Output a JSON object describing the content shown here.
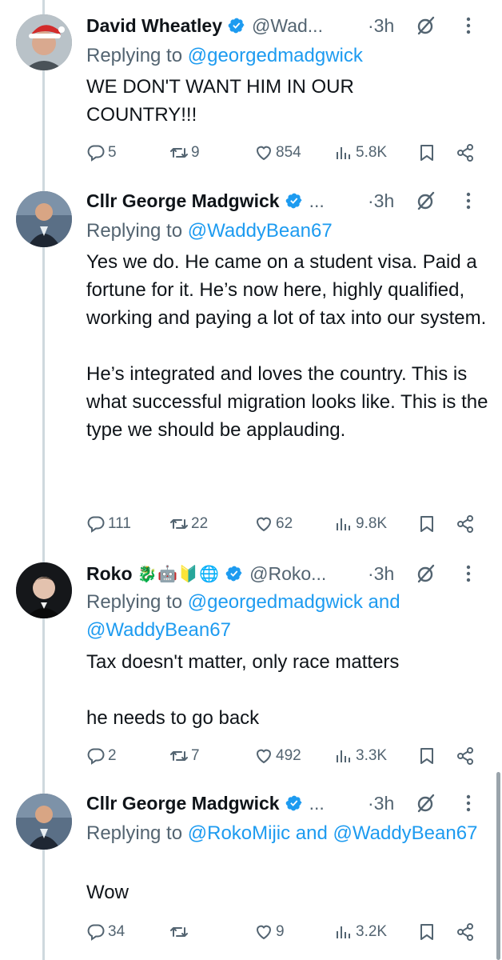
{
  "tweets": [
    {
      "name": "David Wheatley",
      "handle": "@Wad...",
      "time": "·3h",
      "reply_prefix": "Replying to ",
      "reply_to": "@georgedmadgwick",
      "text": "WE DON'T WANT HIM IN OUR\nCOUNTRY!!!",
      "replies": "5",
      "retweets": "9",
      "likes": "854",
      "views": "5.8K"
    },
    {
      "name": "Cllr George Madgwick",
      "handle": "...",
      "time": "·3h",
      "reply_prefix": "Replying to ",
      "reply_to": "@WaddyBean67",
      "text": "Yes we do. He came on a student visa. Paid a fortune for it. He’s now here, highly qualified, working and paying a lot of tax into our system.\n\nHe’s integrated and loves the country. This is what successful migration looks like. This is the type we should be applauding.",
      "replies": "111",
      "retweets": "22",
      "likes": "62",
      "views": "9.8K"
    },
    {
      "name": "Roko",
      "emojis": "🐉🤖🔰🌐",
      "handle": "@Roko...",
      "time": "·3h",
      "reply_prefix": "Replying to ",
      "reply_to": "@georgedmadgwick and @WaddyBean67",
      "text": "Tax doesn't matter, only race matters\n\nhe needs to go back",
      "replies": "2",
      "retweets": "7",
      "likes": "492",
      "views": "3.3K"
    },
    {
      "name": "Cllr George Madgwick",
      "handle": "...",
      "time": "·3h",
      "reply_prefix": "Replying to ",
      "reply_to": "@RokoMijic and @WaddyBean67",
      "text": "Wow",
      "replies": "34",
      "retweets": "",
      "likes": "9",
      "views": "3.2K"
    }
  ],
  "colors": {
    "text": "#0f1419",
    "secondary": "#536471",
    "link": "#1d9bf0",
    "verified": "#1d9bf0",
    "divider": "#cfd9de"
  },
  "icons": [
    "reply-icon",
    "retweet-icon",
    "like-icon",
    "views-icon",
    "bookmark-icon",
    "share-icon",
    "verified-badge-icon",
    "grok-icon",
    "more-icon"
  ]
}
